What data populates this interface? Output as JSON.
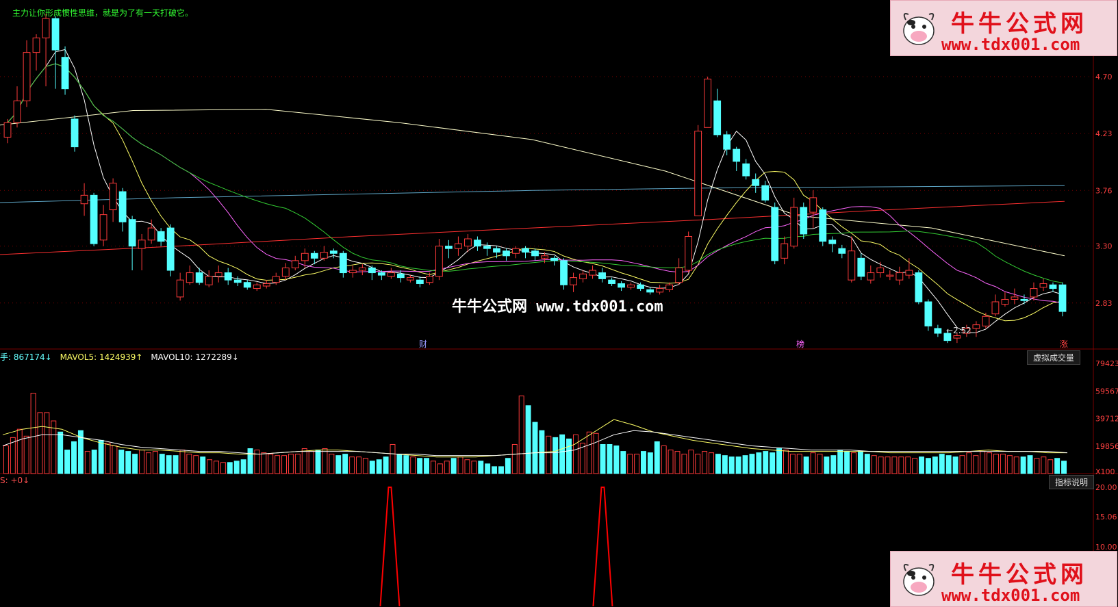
{
  "header_note": "主力让你形成惯性思维，就是为了有一天打破它。",
  "watermark": "牛牛公式网 www.tdx001.com",
  "logo": {
    "title": "牛牛公式网",
    "url": "www.tdx001.com"
  },
  "colors": {
    "up": "#ff3b3b",
    "down": "#54ffff",
    "grid": "#7a0000",
    "ma5": "#ffffff",
    "ma10": "#ffff66",
    "ma20": "#ff66ff",
    "ma30": "#33cc33",
    "ma60": "#5599ff",
    "ma120": "#ffffcc",
    "ma250": "#ff3030",
    "flat": "#5fa7c8"
  },
  "volume_header": {
    "vol_label": "手: 867174↓",
    "mavol5": "MAVOL5: 1424939↑",
    "mavol10": "MAVOL10: 1272289↓"
  },
  "volume_button": "虚拟成交量",
  "indicator_header": "S: +0↓",
  "indicator_button": "指标说明",
  "markers": {
    "cai": "财",
    "bang": "榜",
    "zhang": "涨"
  },
  "chart_data": {
    "type": "candlestick",
    "price_axis": {
      "ticks": [
        "4.70",
        "4.23",
        "3.76",
        "3.30",
        "2.83"
      ],
      "min": 2.45,
      "max": 5.22
    },
    "volume_axis": {
      "ticks": [
        "79423",
        "59567",
        "39712",
        "19856",
        "X100"
      ],
      "max": 79423
    },
    "indicator_axis": {
      "ticks": [
        "20.00",
        "15.06",
        "10.00"
      ],
      "min": 0,
      "max": 20
    },
    "min_price_label": "←2.52",
    "price_ma_series": [
      {
        "key": "ma250",
        "values": [
          3.23,
          3.3,
          3.38,
          3.45,
          3.52,
          3.6,
          3.67
        ]
      },
      {
        "key": "flat",
        "values": [
          3.66,
          3.7,
          3.73,
          3.76,
          3.78,
          3.79,
          3.8
        ]
      },
      {
        "key": "ma120",
        "values": [
          4.3,
          4.42,
          4.43,
          4.32,
          4.18,
          3.92,
          3.55,
          3.45,
          3.22
        ]
      }
    ],
    "candles": [
      [
        4.2,
        4.32,
        4.15,
        4.35
      ],
      [
        4.32,
        4.5,
        4.28,
        4.62
      ],
      [
        4.5,
        4.9,
        4.45,
        5.0
      ],
      [
        4.9,
        5.02,
        4.75,
        5.05
      ],
      [
        5.02,
        5.18,
        4.62,
        5.22
      ],
      [
        5.18,
        4.92,
        4.6,
        5.2
      ],
      [
        4.86,
        4.6,
        4.55,
        4.95
      ],
      [
        4.35,
        4.12,
        4.08,
        4.38
      ],
      [
        3.65,
        3.72,
        3.55,
        3.82
      ],
      [
        3.72,
        3.32,
        3.3,
        3.74
      ],
      [
        3.35,
        3.56,
        3.3,
        3.64
      ],
      [
        3.6,
        3.82,
        3.5,
        3.86
      ],
      [
        3.75,
        3.5,
        3.42,
        3.78
      ],
      [
        3.52,
        3.3,
        3.1,
        3.55
      ],
      [
        3.28,
        3.35,
        3.1,
        3.4
      ],
      [
        3.35,
        3.45,
        3.32,
        3.52
      ],
      [
        3.42,
        3.34,
        3.3,
        3.45
      ],
      [
        3.45,
        3.1,
        3.05,
        3.48
      ],
      [
        2.88,
        3.02,
        2.85,
        3.08
      ],
      [
        3.0,
        3.08,
        2.98,
        3.14
      ],
      [
        3.08,
        3.0,
        2.98,
        3.12
      ],
      [
        2.98,
        3.05,
        2.96,
        3.1
      ],
      [
        3.05,
        3.08,
        3.0,
        3.14
      ],
      [
        3.08,
        3.02,
        2.98,
        3.12
      ],
      [
        3.02,
        3.0,
        2.97,
        3.05
      ],
      [
        3.0,
        2.96,
        2.94,
        3.02
      ],
      [
        2.95,
        2.98,
        2.93,
        3.0
      ],
      [
        2.97,
        2.99,
        2.95,
        3.02
      ],
      [
        3.0,
        3.05,
        2.98,
        3.08
      ],
      [
        3.05,
        3.12,
        3.02,
        3.16
      ],
      [
        3.12,
        3.18,
        3.1,
        3.22
      ],
      [
        3.18,
        3.24,
        3.12,
        3.28
      ],
      [
        3.24,
        3.2,
        3.15,
        3.26
      ],
      [
        3.2,
        3.25,
        3.18,
        3.3
      ],
      [
        3.26,
        3.24,
        3.2,
        3.28
      ],
      [
        3.24,
        3.08,
        3.04,
        3.26
      ],
      [
        3.08,
        3.1,
        3.04,
        3.14
      ],
      [
        3.1,
        3.12,
        3.06,
        3.15
      ],
      [
        3.12,
        3.08,
        3.02,
        3.14
      ],
      [
        3.08,
        3.06,
        3.02,
        3.1
      ],
      [
        3.05,
        3.08,
        3.03,
        3.12
      ],
      [
        3.07,
        3.04,
        3.0,
        3.1
      ],
      [
        3.02,
        3.04,
        3.0,
        3.06
      ],
      [
        3.02,
        2.99,
        2.96,
        3.05
      ],
      [
        3.0,
        3.05,
        2.98,
        3.08
      ],
      [
        3.05,
        3.3,
        3.02,
        3.36
      ],
      [
        3.3,
        3.28,
        3.2,
        3.35
      ],
      [
        3.28,
        3.32,
        3.22,
        3.38
      ],
      [
        3.3,
        3.36,
        3.25,
        3.4
      ],
      [
        3.35,
        3.3,
        3.26,
        3.38
      ],
      [
        3.3,
        3.28,
        3.22,
        3.33
      ],
      [
        3.28,
        3.25,
        3.2,
        3.3
      ],
      [
        3.26,
        3.22,
        3.18,
        3.28
      ],
      [
        3.24,
        3.28,
        3.2,
        3.3
      ],
      [
        3.28,
        3.25,
        3.2,
        3.3
      ],
      [
        3.26,
        3.22,
        3.18,
        3.28
      ],
      [
        3.2,
        3.22,
        3.16,
        3.25
      ],
      [
        3.2,
        3.18,
        3.14,
        3.22
      ],
      [
        3.18,
        2.98,
        2.94,
        3.2
      ],
      [
        2.98,
        3.04,
        2.92,
        3.08
      ],
      [
        3.03,
        3.07,
        3.0,
        3.1
      ],
      [
        3.06,
        3.1,
        3.03,
        3.14
      ],
      [
        3.08,
        3.03,
        3.0,
        3.12
      ],
      [
        3.02,
        2.99,
        2.97,
        3.04
      ],
      [
        2.99,
        2.96,
        2.93,
        3.01
      ],
      [
        2.96,
        2.98,
        2.94,
        3.0
      ],
      [
        2.98,
        2.95,
        2.93,
        3.0
      ],
      [
        2.94,
        2.92,
        2.9,
        2.96
      ],
      [
        2.92,
        2.95,
        2.9,
        2.98
      ],
      [
        2.94,
        2.98,
        2.92,
        3.0
      ],
      [
        3.0,
        3.12,
        2.98,
        3.2
      ],
      [
        3.1,
        3.38,
        3.08,
        3.42
      ],
      [
        3.55,
        4.25,
        3.8,
        4.3
      ],
      [
        4.28,
        4.68,
        4.4,
        4.7
      ],
      [
        4.5,
        4.22,
        4.2,
        4.6
      ],
      [
        4.22,
        4.1,
        4.05,
        4.25
      ],
      [
        4.1,
        4.0,
        3.92,
        4.12
      ],
      [
        3.98,
        3.88,
        3.85,
        4.02
      ],
      [
        3.85,
        3.8,
        3.74,
        3.9
      ],
      [
        3.8,
        3.68,
        3.66,
        3.84
      ],
      [
        3.62,
        3.18,
        3.15,
        3.66
      ],
      [
        3.2,
        3.32,
        3.15,
        3.38
      ],
      [
        3.3,
        3.62,
        3.28,
        3.7
      ],
      [
        3.62,
        3.4,
        3.36,
        3.66
      ],
      [
        3.58,
        3.7,
        3.45,
        3.76
      ],
      [
        3.6,
        3.34,
        3.3,
        3.62
      ],
      [
        3.35,
        3.32,
        3.25,
        3.38
      ],
      [
        3.28,
        3.24,
        3.2,
        3.31
      ],
      [
        3.02,
        3.26,
        3.0,
        3.38
      ],
      [
        3.2,
        3.05,
        3.02,
        3.24
      ],
      [
        3.02,
        3.08,
        2.99,
        3.14
      ],
      [
        3.08,
        3.12,
        3.04,
        3.17
      ],
      [
        3.05,
        3.06,
        3.02,
        3.1
      ],
      [
        3.02,
        3.08,
        2.98,
        3.13
      ],
      [
        3.06,
        3.1,
        3.03,
        3.2
      ],
      [
        3.08,
        2.84,
        2.82,
        3.1
      ],
      [
        2.84,
        2.64,
        2.6,
        2.86
      ],
      [
        2.62,
        2.58,
        2.55,
        2.65
      ],
      [
        2.58,
        2.52,
        2.5,
        2.6
      ],
      [
        2.54,
        2.56,
        2.5,
        2.58
      ],
      [
        2.58,
        2.62,
        2.55,
        2.65
      ],
      [
        2.62,
        2.65,
        2.55,
        2.68
      ],
      [
        2.64,
        2.72,
        2.62,
        2.75
      ],
      [
        2.74,
        2.84,
        2.72,
        2.9
      ],
      [
        2.82,
        2.86,
        2.8,
        2.92
      ],
      [
        2.86,
        2.88,
        2.82,
        2.95
      ],
      [
        2.86,
        2.85,
        2.82,
        2.9
      ],
      [
        2.88,
        2.95,
        2.85,
        3.0
      ],
      [
        2.96,
        2.99,
        2.93,
        3.03
      ],
      [
        2.98,
        2.95,
        2.92,
        3.0
      ],
      [
        2.98,
        2.76,
        2.72,
        3.0
      ]
    ],
    "volumes": [
      20,
      26,
      32,
      27,
      58,
      44,
      44,
      38,
      30,
      17,
      23,
      31,
      16,
      17,
      24,
      22,
      20,
      17,
      16,
      14,
      17,
      15,
      16,
      14,
      13,
      13,
      17,
      14,
      13,
      12,
      10,
      9,
      8,
      8,
      9,
      10,
      18,
      17,
      15,
      14,
      13,
      13,
      14,
      14,
      18,
      16,
      17,
      18,
      14,
      13,
      14,
      12,
      12,
      11,
      9,
      10,
      12,
      21,
      14,
      13,
      12,
      11,
      11,
      9,
      7,
      9,
      11,
      12,
      10,
      9,
      9,
      7,
      5,
      5,
      11,
      21,
      56,
      49,
      37,
      31,
      27,
      26,
      28,
      25,
      28,
      22,
      30,
      29,
      21,
      21,
      20,
      16,
      14,
      14,
      16,
      15,
      23,
      20,
      17,
      16,
      14,
      17,
      14,
      16,
      15,
      14,
      13,
      12,
      12,
      13,
      14,
      15,
      16,
      15,
      18,
      17,
      14,
      14,
      12,
      15,
      14,
      12,
      13,
      17,
      16,
      15,
      16,
      14,
      13,
      12,
      12,
      12,
      12,
      12,
      11,
      12,
      11,
      12,
      14,
      13,
      12,
      13,
      15,
      13,
      16,
      15,
      14,
      14,
      13,
      12,
      12,
      13,
      11,
      12,
      10,
      11,
      9
    ],
    "mavol5_line": [
      28,
      32,
      34,
      32,
      26,
      22,
      19,
      17,
      17,
      16,
      15,
      15,
      14,
      14,
      15,
      16,
      17,
      17,
      16,
      15,
      14,
      13,
      12,
      12,
      12,
      13,
      14,
      15,
      16,
      21,
      30,
      39,
      35,
      30,
      27,
      24,
      22,
      20,
      18,
      17,
      16,
      16,
      16,
      16,
      16,
      15,
      15,
      15,
      15,
      16,
      17,
      16,
      16,
      15,
      15
    ],
    "mavol10_line": [
      20,
      25,
      28,
      28,
      26,
      24,
      21,
      19,
      18,
      17,
      16,
      16,
      15,
      14,
      15,
      16,
      16,
      16,
      16,
      15,
      14,
      14,
      13,
      13,
      13,
      13,
      14,
      15,
      15,
      17,
      22,
      28,
      31,
      30,
      28,
      26,
      24,
      22,
      20,
      19,
      18,
      17,
      17,
      17,
      16,
      16,
      16,
      16,
      16,
      16,
      16,
      16,
      16,
      16,
      15
    ],
    "indicator_spikes": [
      {
        "from": 0.0,
        "to": 0.0,
        "peak": 20,
        "index": 20
      },
      {
        "from": 0.0,
        "to": 0.0,
        "peak": 20,
        "index": 31
      }
    ]
  }
}
